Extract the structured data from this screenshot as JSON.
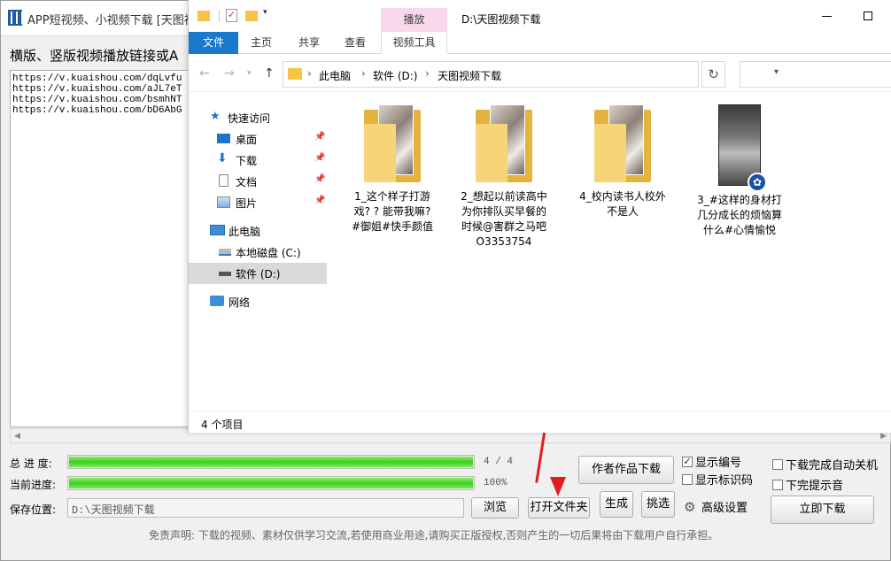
{
  "app": {
    "title": "APP短视频、小视频下载 [天图视频",
    "prompt": "横版、竖版视频播放链接或A",
    "urls": [
      "https://v.kuaishou.com/dqLvfu",
      "https://v.kuaishou.com/aJL7eT",
      "https://v.kuaishou.com/bsmhNT",
      "https://v.kuaishou.com/bD6AbG"
    ],
    "total_progress_label": "总 进 度:",
    "total_progress_text": "4 / 4",
    "total_progress_fraction": 1.0,
    "current_progress_label": "当前进度:",
    "current_progress_text": "100%",
    "current_progress_fraction": 1.0,
    "save_label": "保存位置:",
    "save_path": "D:\\天图视频下载",
    "buttons": {
      "browse": "浏览",
      "open_folder": "打开文件夹",
      "generate": "生成",
      "pick": "挑选",
      "author_download": "作者作品下载",
      "download_now": "立即下载",
      "advanced": "高级设置"
    },
    "checkboxes": {
      "show_number": {
        "label": "显示编号",
        "checked": true
      },
      "show_mark": {
        "label": "显示标识码",
        "checked": false
      },
      "auto_shutdown": {
        "label": "下载完成自动关机",
        "checked": false
      },
      "done_sound": {
        "label": "下完提示音",
        "checked": false
      }
    },
    "disclaimer": "免责声明: 下载的视频、素材仅供学习交流,若使用商业用途,请购买正版授权,否则产生的一切后果将由下载用户自行承担。",
    "accent_color": "#e11d1d"
  },
  "explorer": {
    "window_title": "D:\\天图视频下载",
    "context_tab": "播放",
    "ribbon_tabs": [
      "文件",
      "主页",
      "共享",
      "查看",
      "视频工具"
    ],
    "breadcrumbs": [
      "此电脑",
      "软件 (D:)",
      "天图视频下载"
    ],
    "nav": [
      {
        "label": "快速访问",
        "icon": "star-icon"
      },
      {
        "label": "桌面",
        "icon": "desktop-icon"
      },
      {
        "label": "下载",
        "icon": "download-arrow-icon"
      },
      {
        "label": "文档",
        "icon": "document-icon"
      },
      {
        "label": "图片",
        "icon": "pictures-icon"
      },
      {
        "label": "此电脑",
        "icon": "computer-icon"
      },
      {
        "label": "本地磁盘 (C:)",
        "icon": "drive-icon"
      },
      {
        "label": "软件 (D:)",
        "icon": "drive-icon"
      },
      {
        "label": "网络",
        "icon": "network-icon"
      }
    ],
    "items": [
      {
        "name": "1_这个样子打游戏? ? 能带我嘛? #御姐#快手颜值",
        "kind": "folder"
      },
      {
        "name": "2_想起以前读高中为你排队买早餐的时候@害群之马吧O3353754",
        "kind": "folder"
      },
      {
        "name": "4_校内读书人校外不是人",
        "kind": "folder"
      },
      {
        "name": "3_#这样的身材打几分成长的烦恼算什么#心情愉悦",
        "kind": "video"
      }
    ],
    "status": "4 个项目"
  }
}
